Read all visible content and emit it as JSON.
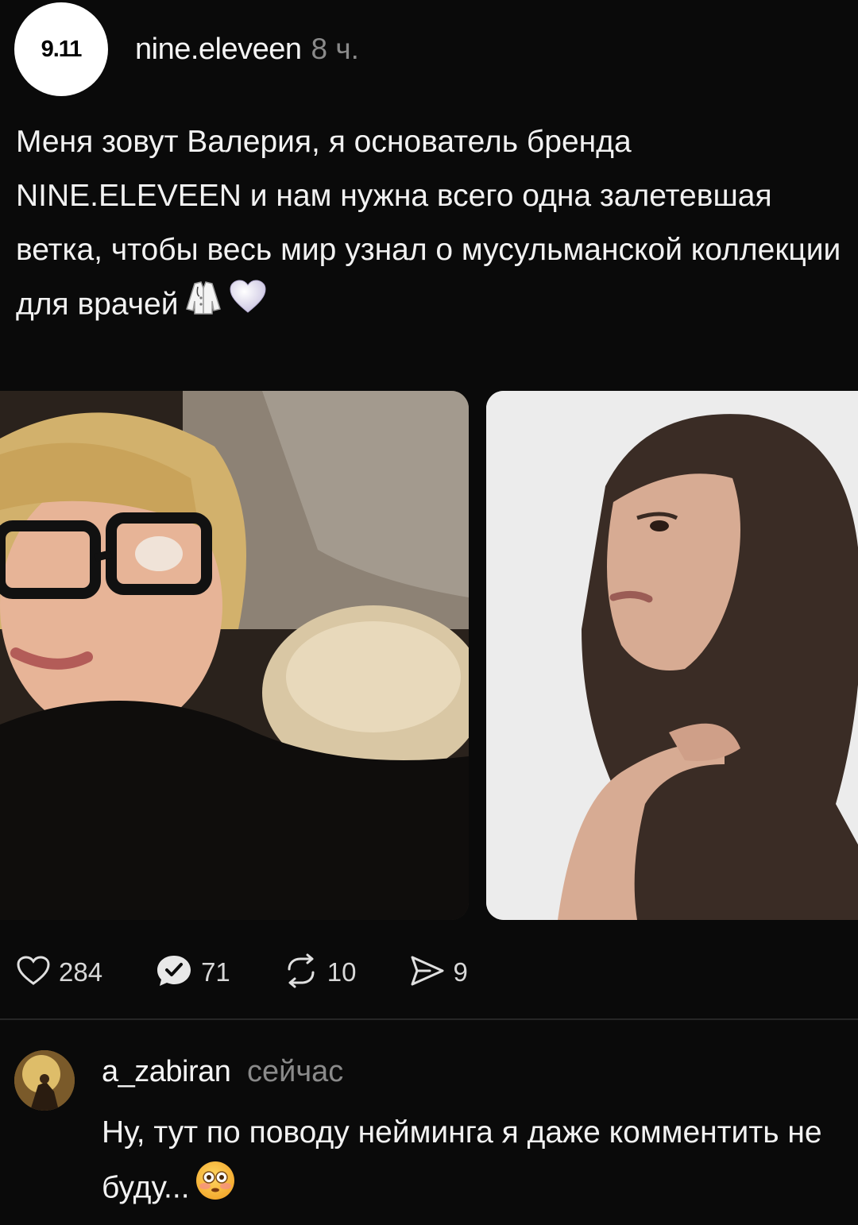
{
  "post": {
    "avatar_text": "9.11",
    "author": "nine.eleveen",
    "time": "8 ч.",
    "text": "Меня зовут Валерия, я основатель бренда NINE.ELEVEEN и нам нужна всего одна залетевшая ветка, чтобы весь мир узнал о мусульманской коллекции для врачей",
    "emojis": [
      "lab-coat-icon",
      "white-heart-icon"
    ]
  },
  "actions": {
    "likes": "284",
    "comments": "71",
    "reposts": "10",
    "shares": "9"
  },
  "comment": {
    "author": "a_zabiran",
    "time": "сейчас",
    "text": "Ну, тут по поводу нейминга я даже комментить не буду...",
    "emoji": "flushed-face-icon"
  },
  "colors": {
    "background": "#0a0a0a",
    "text": "#f2f2f2",
    "muted": "#8a8a8a",
    "divider": "#262626"
  }
}
